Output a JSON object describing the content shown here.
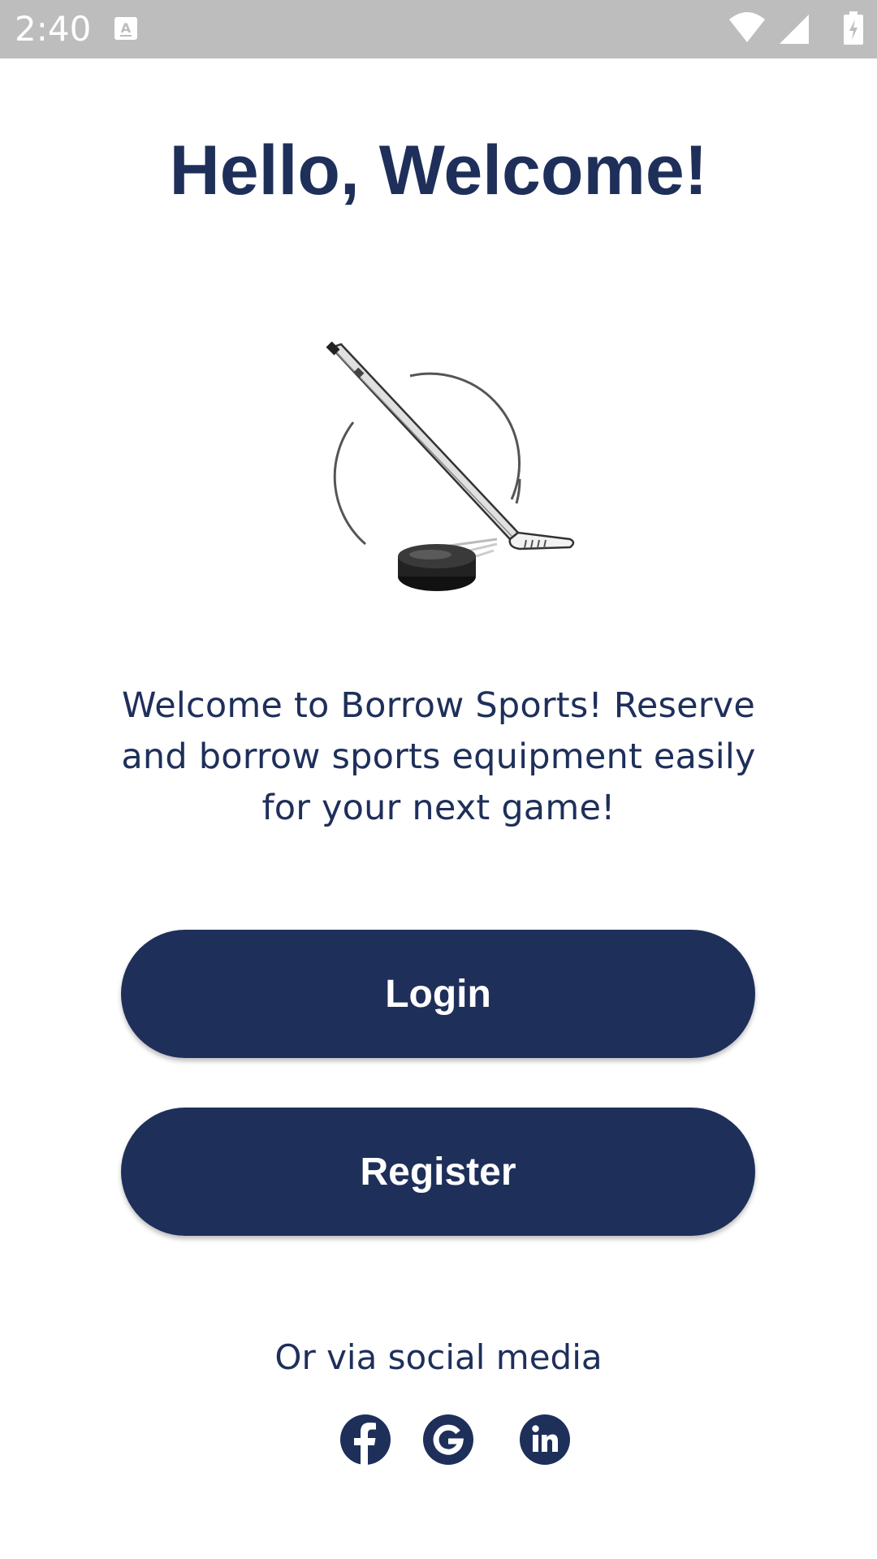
{
  "status_bar": {
    "time": "2:40",
    "icons": [
      "keyboard-a-icon",
      "wifi-icon",
      "signal-icon",
      "battery-charging-icon"
    ]
  },
  "header": {
    "title": "Hello, Welcome!"
  },
  "logo": {
    "icon": "hockey-stick-puck-logo"
  },
  "main": {
    "description": "Welcome to Borrow Sports! Reserve and borrow sports equipment easily for your next game!"
  },
  "actions": {
    "login_label": "Login",
    "register_label": "Register"
  },
  "social": {
    "caption": "Or via social media",
    "icons": [
      "facebook-icon",
      "google-icon",
      "linkedin-icon"
    ]
  },
  "colors": {
    "primary": "#1e2f5a",
    "status_bar": "#bdbdbd",
    "background": "#ffffff"
  }
}
